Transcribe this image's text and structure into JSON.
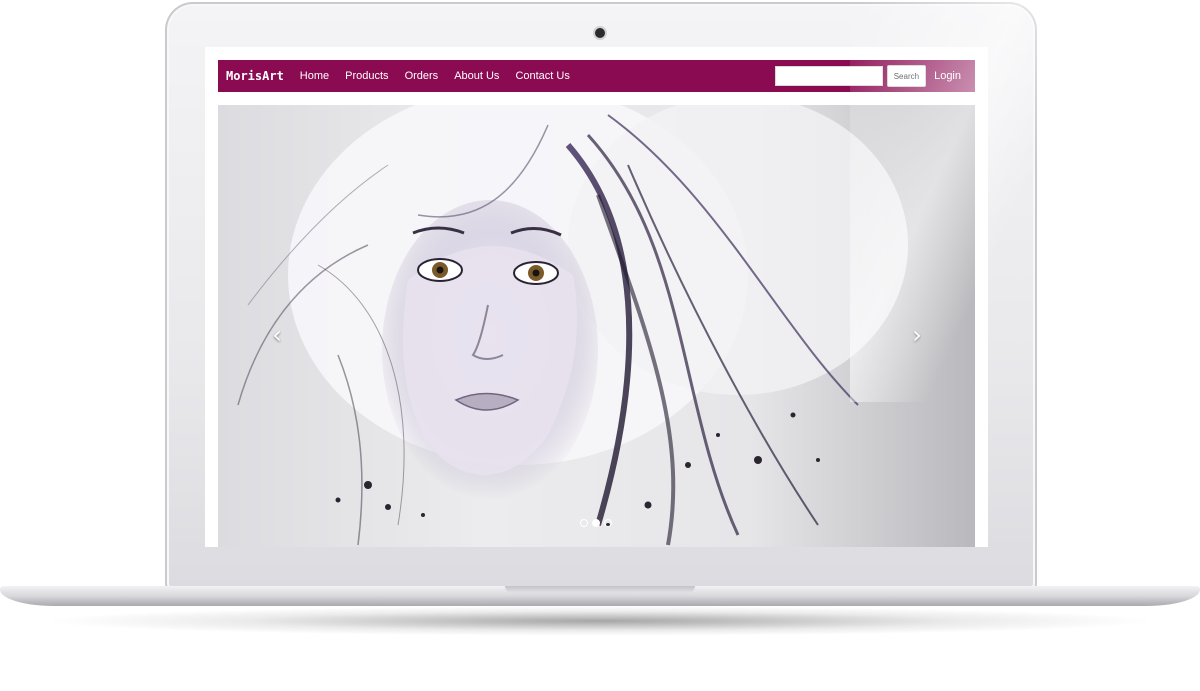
{
  "navbar": {
    "brand": "MorisArt",
    "links": [
      "Home",
      "Products",
      "Orders",
      "About Us",
      "Contact Us"
    ],
    "search_button": "Search",
    "search_value": "",
    "login": "Login",
    "color": "#8a0b52"
  },
  "carousel": {
    "prev_icon": "chevron-left-icon",
    "next_icon": "chevron-right-icon",
    "prev_glyph": "‹",
    "next_glyph": "›",
    "slide_count": 3,
    "active_slide": 1
  },
  "device": {
    "type": "laptop"
  }
}
